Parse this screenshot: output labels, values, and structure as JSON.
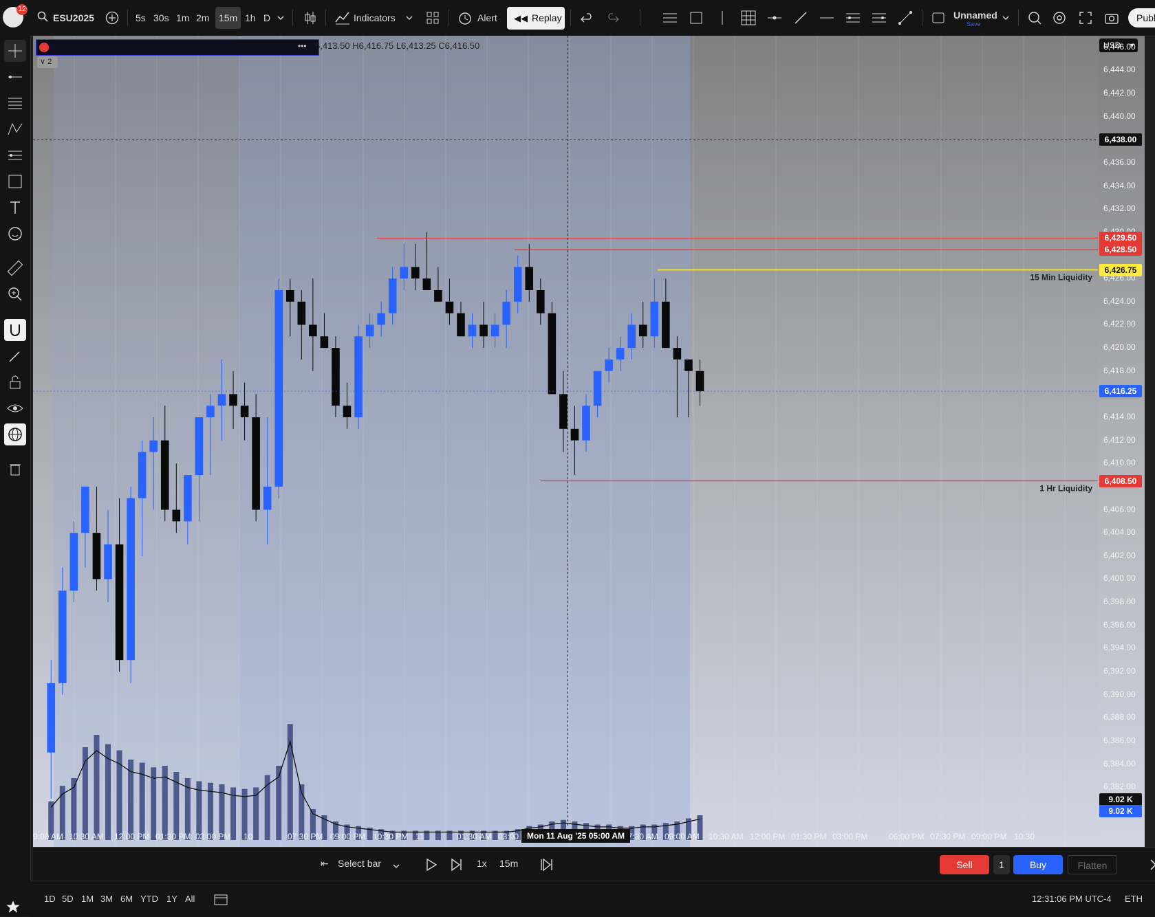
{
  "topbar": {
    "notifications": "12",
    "symbol": "ESU2025",
    "intervals": [
      "5s",
      "30s",
      "1m",
      "2m",
      "15m",
      "1h",
      "D"
    ],
    "active_interval": "15m",
    "indicators_label": "Indicators",
    "alert_label": "Alert",
    "replay_label": "Replay",
    "layout_name": "Unnamed",
    "layout_status": "Save",
    "publish_label": "Publ"
  },
  "legend": {
    "ohlc_text": "6,413.50  H6,416.75  L6,413.25  C6,416.50",
    "collapsed_count": "2"
  },
  "axis": {
    "currency": "USD",
    "ticks": [
      "6,446.00",
      "6,444.00",
      "6,442.00",
      "6,440.00",
      "6,436.00",
      "6,434.00",
      "6,432.00",
      "6,430.00",
      "6,426.00",
      "6,424.00",
      "6,422.00",
      "6,420.00",
      "6,418.00",
      "6,414.00",
      "6,412.00",
      "6,410.00",
      "6,406.00",
      "6,404.00",
      "6,402.00",
      "6,400.00",
      "6,398.00",
      "6,396.00",
      "6,394.00",
      "6,392.00",
      "6,390.00",
      "6,388.00",
      "6,386.00",
      "6,384.00",
      "6,382.00"
    ],
    "crosshair_price": "6,438.00",
    "level_1": "6,429.50",
    "level_2": "6,428.50",
    "level_yellow": "6,426.75",
    "current_price": "6,416.25",
    "level_low": "6,408.50",
    "volume_label_1": "9.02 K",
    "volume_label_2": "9.02 K"
  },
  "annotations": {
    "liq15": "15 Min Liquidity",
    "liq1h": "1 Hr Liquidity"
  },
  "xaxis": {
    "labels": [
      "9:00 AM",
      "10:30 AM",
      "12:00 PM",
      "01:30 PM",
      "03:00 PM",
      "10",
      "07:30 PM",
      "09:00 PM",
      "10:30 PM",
      "11",
      "01:30 AM",
      "03:00",
      "07:30 AM",
      "09:00 AM",
      "10:30 AM",
      "12:00 PM",
      "01:30 PM",
      "03:00 PM",
      "06:00 PM",
      "07:30 PM",
      "09:00 PM",
      "10:30"
    ],
    "crosshair_date": "Mon 11 Aug '25",
    "crosshair_time": "05:00 AM"
  },
  "replaybar": {
    "select_bar": "Select bar",
    "speed": "1x",
    "interval": "15m"
  },
  "trade": {
    "sell": "Sell",
    "qty": "1",
    "buy": "Buy",
    "flatten": "Flatten"
  },
  "statusbar": {
    "ranges": [
      "1D",
      "5D",
      "1M",
      "3M",
      "6M",
      "YTD",
      "1Y",
      "All"
    ],
    "time": "12:31:06 PM UTC-4",
    "session": "ETH"
  },
  "colors": {
    "up": "#2962ff",
    "down": "#0a0a0a",
    "level": "#e53935",
    "yellow": "#ffeb3b",
    "volume": "#4e5a8c",
    "volume_ma": "#111111"
  },
  "chart_data": {
    "type": "candlestick",
    "interval": "15m",
    "ylim": [
      6381,
      6447
    ],
    "candles": [
      [
        6385,
        6393,
        6381,
        6391
      ],
      [
        6391,
        6401,
        6390,
        6399
      ],
      [
        6399,
        6405,
        6398,
        6404
      ],
      [
        6404,
        6407,
        6401,
        6408
      ],
      [
        6404,
        6408,
        6399,
        6400
      ],
      [
        6400,
        6406,
        6398,
        6403
      ],
      [
        6403,
        6407,
        6392,
        6393
      ],
      [
        6393,
        6408,
        6391,
        6407
      ],
      [
        6407,
        6412,
        6402,
        6411
      ],
      [
        6411,
        6414,
        6406,
        6412
      ],
      [
        6412,
        6415,
        6405,
        6406
      ],
      [
        6406,
        6410,
        6404,
        6405
      ],
      [
        6405,
        6407,
        6403,
        6409
      ],
      [
        6409,
        6414,
        6405,
        6414
      ],
      [
        6414,
        6416,
        6409,
        6415
      ],
      [
        6415,
        6419,
        6412,
        6416
      ],
      [
        6416,
        6418,
        6413,
        6415
      ],
      [
        6415,
        6417,
        6412,
        6414
      ],
      [
        6414,
        6416,
        6405,
        6406
      ],
      [
        6406,
        6414,
        6403,
        6408
      ],
      [
        6408,
        6426,
        6407,
        6425
      ],
      [
        6425,
        6426,
        6421,
        6424
      ],
      [
        6424,
        6425,
        6419,
        6422
      ],
      [
        6422,
        6426,
        6418,
        6421
      ],
      [
        6421,
        6423,
        6420,
        6420
      ],
      [
        6420,
        6421,
        6414,
        6415
      ],
      [
        6415,
        6417,
        6413,
        6414
      ],
      [
        6414,
        6422,
        6413,
        6421
      ],
      [
        6421,
        6423,
        6420,
        6422
      ],
      [
        6422,
        6424,
        6421,
        6423
      ],
      [
        6423,
        6427,
        6422,
        6426
      ],
      [
        6426,
        6429,
        6425,
        6427
      ],
      [
        6427,
        6429,
        6425,
        6426
      ],
      [
        6426,
        6430,
        6425,
        6425
      ],
      [
        6425,
        6427,
        6424,
        6424
      ],
      [
        6424,
        6426,
        6422,
        6423
      ],
      [
        6423,
        6424,
        6421,
        6421
      ],
      [
        6421,
        6423,
        6420,
        6422
      ],
      [
        6422,
        6424,
        6420,
        6421
      ],
      [
        6421,
        6423,
        6420,
        6422
      ],
      [
        6422,
        6425,
        6420,
        6424
      ],
      [
        6424,
        6428,
        6423,
        6427
      ],
      [
        6427,
        6429,
        6424,
        6425
      ],
      [
        6425,
        6426,
        6422,
        6423
      ],
      [
        6423,
        6424,
        6417,
        6416
      ],
      [
        6416,
        6418,
        6411,
        6413
      ],
      [
        6413,
        6415,
        6409,
        6412
      ],
      [
        6412,
        6416,
        6411,
        6415
      ],
      [
        6415,
        6418,
        6414,
        6418
      ],
      [
        6418,
        6420,
        6417,
        6419
      ],
      [
        6419,
        6421,
        6418,
        6420
      ],
      [
        6420,
        6423,
        6419,
        6422
      ],
      [
        6422,
        6424,
        6420,
        6421
      ],
      [
        6421,
        6426,
        6420,
        6424
      ],
      [
        6424,
        6426,
        6420,
        6420
      ],
      [
        6420,
        6421,
        6414,
        6419
      ],
      [
        6419,
        6419,
        6414,
        6418
      ],
      [
        6418,
        6419,
        6415,
        6416.25
      ]
    ],
    "volume": [
      25,
      35,
      40,
      60,
      68,
      62,
      58,
      52,
      50,
      47,
      48,
      44,
      40,
      38,
      37,
      36,
      34,
      33,
      34,
      42,
      48,
      75,
      36,
      20,
      16,
      12,
      10,
      9,
      8,
      7,
      6,
      6,
      6,
      6,
      6,
      6,
      6,
      6,
      6,
      6,
      6,
      7,
      9,
      10,
      12,
      13,
      12,
      11,
      10,
      10,
      9,
      9,
      10,
      10,
      11,
      12,
      14,
      16
    ],
    "levels": {
      "resistance_1": 6429.5,
      "resistance_2": 6428.5,
      "liquidity_15m": 6426.75,
      "liquidity_1h": 6408.5
    }
  }
}
